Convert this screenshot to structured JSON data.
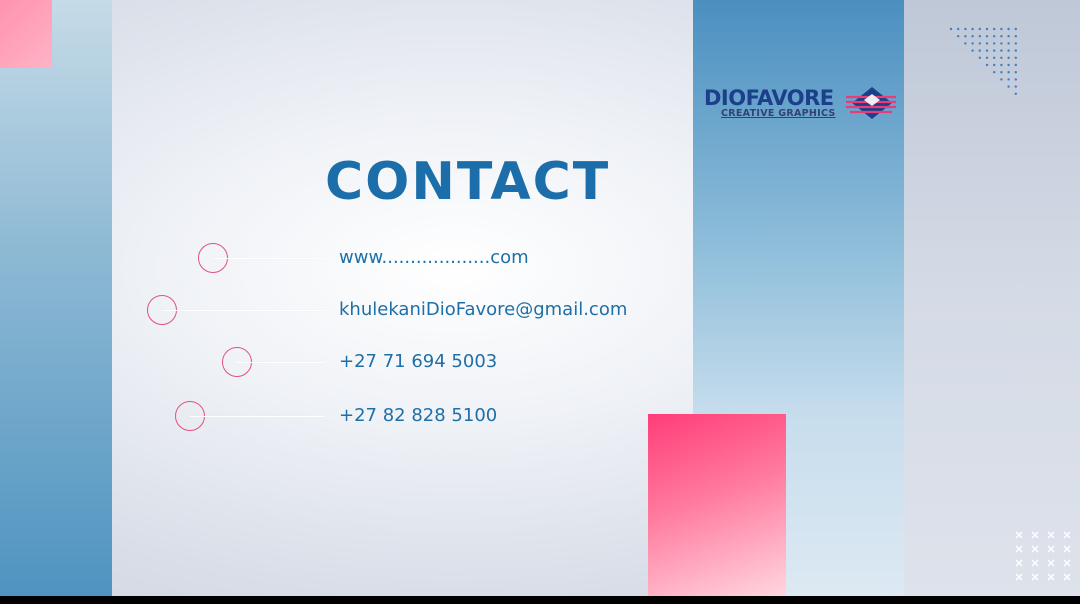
{
  "slide": {
    "title": "CONTACT",
    "brand": {
      "name": "DIOFAVORE",
      "tagline": "CREATIVE GRAPHICS",
      "colors": {
        "navy": "#1c3f8a",
        "pink": "#e83b77"
      }
    },
    "contacts": [
      {
        "type": "website",
        "text": "www...................com"
      },
      {
        "type": "email",
        "text": "khulekaniDioFavore@gmail.com"
      },
      {
        "type": "phone",
        "text": "+27 71 694 5003"
      },
      {
        "type": "phone",
        "text": "+27 82 828 5100"
      }
    ],
    "colors": {
      "title": "#1b6ea9",
      "text": "#1e6fa7",
      "circle": "#e2517f",
      "accent_pink": "#ff3d78",
      "accent_blue": "#4b8fc0"
    }
  }
}
